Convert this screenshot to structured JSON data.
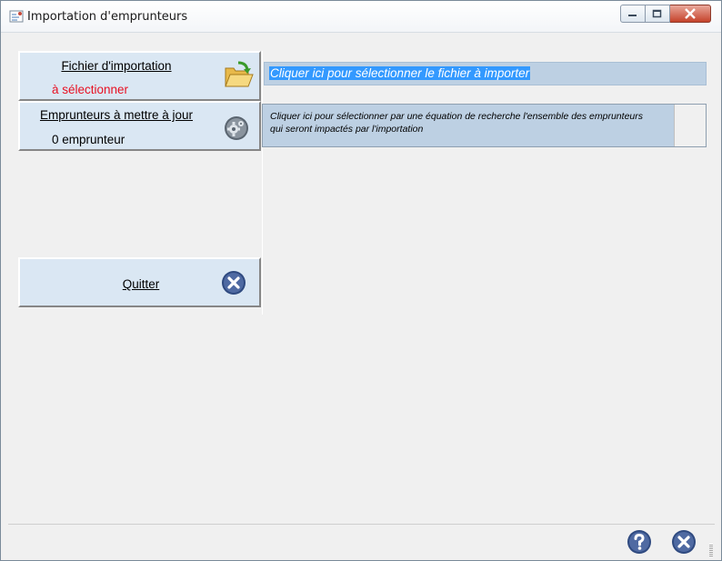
{
  "window": {
    "title": "Importation d'emprunteurs",
    "icon": "app-icon",
    "controls": [
      "minimize-icon",
      "maximize-icon",
      "close-icon"
    ]
  },
  "left_panel": {
    "file_card": {
      "title": "Fichier d'importation",
      "status": "à sélectionner",
      "status_color": "#e81123",
      "icon": "folder-icon"
    },
    "borrowers_card": {
      "title": "Emprunteurs à mettre à jour",
      "status": "0 emprunteur",
      "icon": "gear-icon"
    },
    "quit_button": {
      "label": "Quitter",
      "icon": "close-circle-icon"
    }
  },
  "main": {
    "select_file_button": "Cliquer ici pour sélectionner le fichier à importer",
    "equation_button": "Cliquer ici pour sélectionner par une équation de recherche l'ensemble des emprunteurs qui seront impactés par l'importation"
  },
  "statusbar": {
    "help_icon": "help-icon",
    "close_icon": "close-circle-icon"
  },
  "colors": {
    "card_bg": "#dae7f3",
    "button_bg": "#bdd0e3",
    "selection": "#3399ff",
    "round_icon": "#2f4a80"
  }
}
